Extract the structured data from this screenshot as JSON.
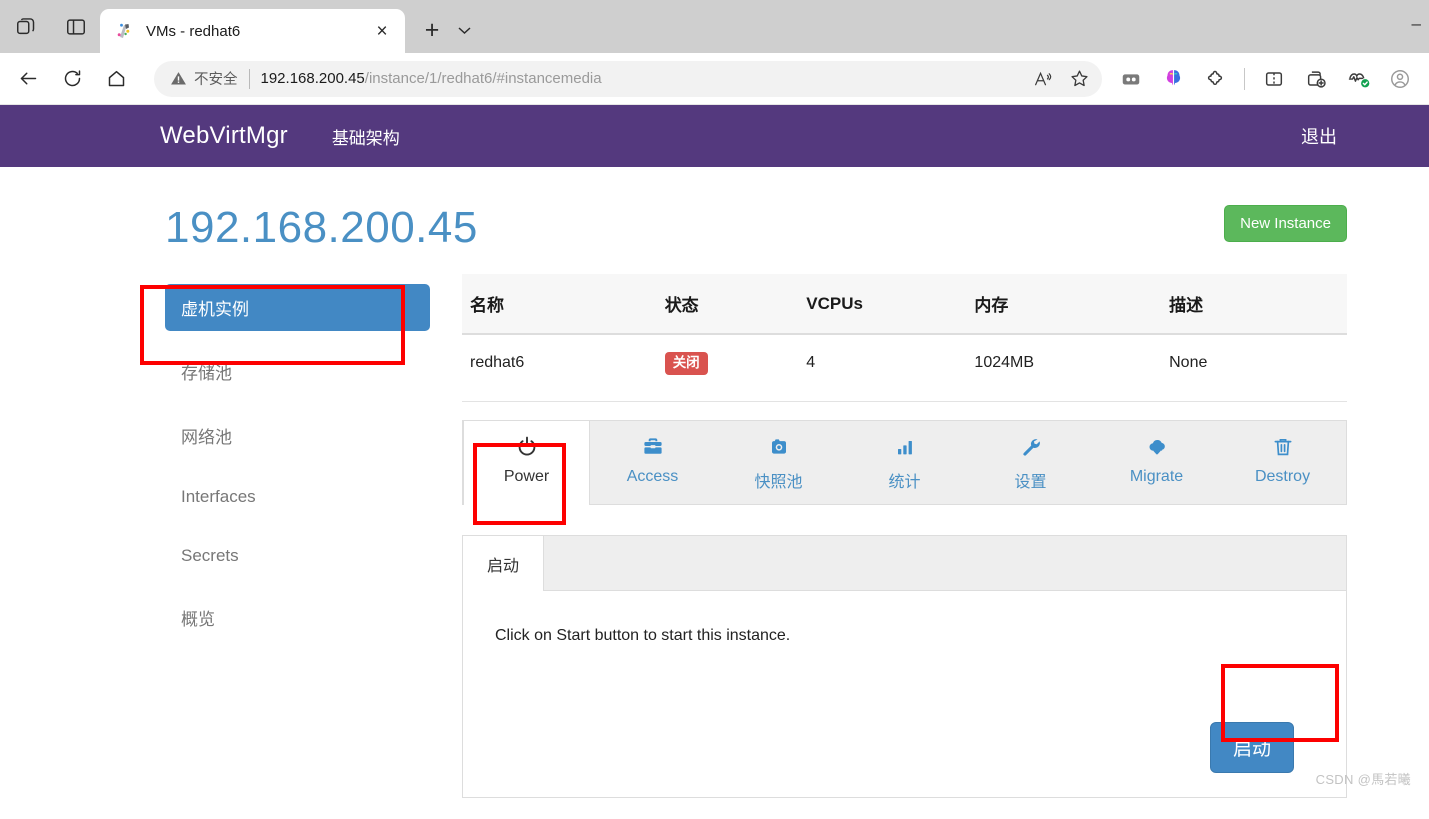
{
  "browser": {
    "tab": {
      "title": "VMs - redhat6",
      "close_label": "×",
      "favicon_name": "vm-site-favicon"
    },
    "new_tab_label": "+",
    "tab_list_caret": "⌄",
    "window_minimize_label": "–",
    "toolbar": {
      "back_label": "←",
      "reload_label": "↻",
      "home_label": "⌂",
      "security_text": "不安全",
      "url_domain": "192.168.200.45",
      "url_path": "/instance/1/redhat6/#instancemedia",
      "read_aloud_label": "A",
      "favorite_label": "☆"
    },
    "extensions": [
      "split-screen-icon",
      "copilot-icon",
      "extensions-puzzle-icon",
      "browser-essentials-icon",
      "collections-icon",
      "performance-health-icon",
      "profile-icon"
    ]
  },
  "app": {
    "brand": "WebVirtMgr",
    "nav_link": "基础架构",
    "logout": "退出",
    "navbar_color": "#54397e"
  },
  "page": {
    "title": "192.168.200.45",
    "new_instance_button": "New Instance",
    "accent_blue": "#4288c4",
    "accent_green": "#5cb85c"
  },
  "sidebar": {
    "items": [
      {
        "label": "虚机实例",
        "active": true
      },
      {
        "label": "存储池",
        "active": false
      },
      {
        "label": "网络池",
        "active": false
      },
      {
        "label": "Interfaces",
        "active": false
      },
      {
        "label": "Secrets",
        "active": false
      },
      {
        "label": "概览",
        "active": false
      }
    ]
  },
  "table": {
    "headers": [
      "名称",
      "状态",
      "VCPUs",
      "内存",
      "描述"
    ],
    "rows": [
      {
        "name": "redhat6",
        "state": "关闭",
        "state_color": "#d9534f",
        "vcpus": "4",
        "memory": "1024MB",
        "description": "None"
      }
    ]
  },
  "instance_tabs": [
    {
      "label": "Power",
      "icon": "power-icon",
      "active": true
    },
    {
      "label": "Access",
      "icon": "briefcase-icon",
      "active": false
    },
    {
      "label": "快照池",
      "icon": "camera-icon",
      "active": false
    },
    {
      "label": "统计",
      "icon": "bar-chart-icon",
      "active": false
    },
    {
      "label": "设置",
      "icon": "wrench-icon",
      "active": false
    },
    {
      "label": "Migrate",
      "icon": "cloud-download-icon",
      "active": false
    },
    {
      "label": "Destroy",
      "icon": "trash-icon",
      "active": false
    }
  ],
  "power_panel": {
    "tab_label": "启动",
    "message": "Click on Start button to start this instance.",
    "start_button": "启动"
  },
  "annotations": {
    "color": "#fd0000",
    "boxes": [
      "sidebar-vm-instances",
      "power-tab",
      "start-button"
    ]
  },
  "watermark": "CSDN @馬若曦"
}
